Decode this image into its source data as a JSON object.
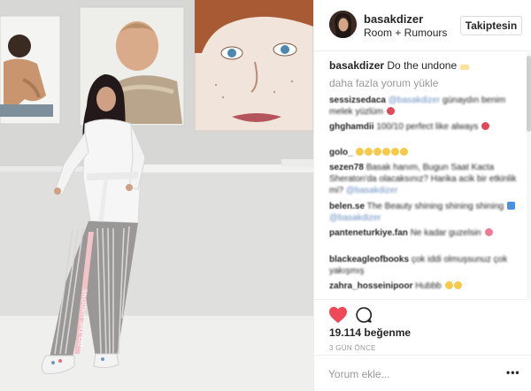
{
  "post": {
    "username": "basakdizer",
    "location": "Room + Rumours",
    "follow_label": "Takiptesin",
    "caption": "Do the undone",
    "load_more": "daha fazla yorum yükle",
    "likes": "19.114 beğenme",
    "time_ago": "3 GÜN ÖNCE",
    "comment_placeholder": "Yorum ekle...",
    "more_options": "•••",
    "pants_text": "DO THE UNDONE"
  },
  "comments": [
    {
      "user": "sessizsedaca",
      "mention": "@basakdizer",
      "text": "günaydın benim melek yüzlüm",
      "emoji": "red"
    },
    {
      "user": "ghghamdii",
      "text": "100/10 perfect like always",
      "emoji": "red"
    },
    {
      "user": "golo_",
      "text": "",
      "emoji": "yellow"
    },
    {
      "user": "sezen78",
      "text": "Basak hanım, Bugun Saat Kacta Sheraton'da olacaksınız? Harika acik bir etkinlik mi?",
      "mention": "@basakdizer"
    },
    {
      "user": "belen.se",
      "text": "The Beauty shining shining shining",
      "mention": "@basakdizer",
      "emoji": "blue"
    },
    {
      "user": "panteneturkiye.fan",
      "text": "Ne kadar guzelsin",
      "emoji": "pink"
    },
    {
      "user": "blackeagleofbooks",
      "text": "çok iddi olmuşsunuz çok yakışmış"
    },
    {
      "user": "zahra_hosseinipoor",
      "text": "Hubbb",
      "emoji": "yellow"
    }
  ],
  "colors": {
    "heart": "#ed4956",
    "mention": "#6b8ec4",
    "muted": "#999999",
    "text": "#262626"
  },
  "icons": [
    "heart-icon",
    "comment-icon",
    "more-options-icon"
  ]
}
